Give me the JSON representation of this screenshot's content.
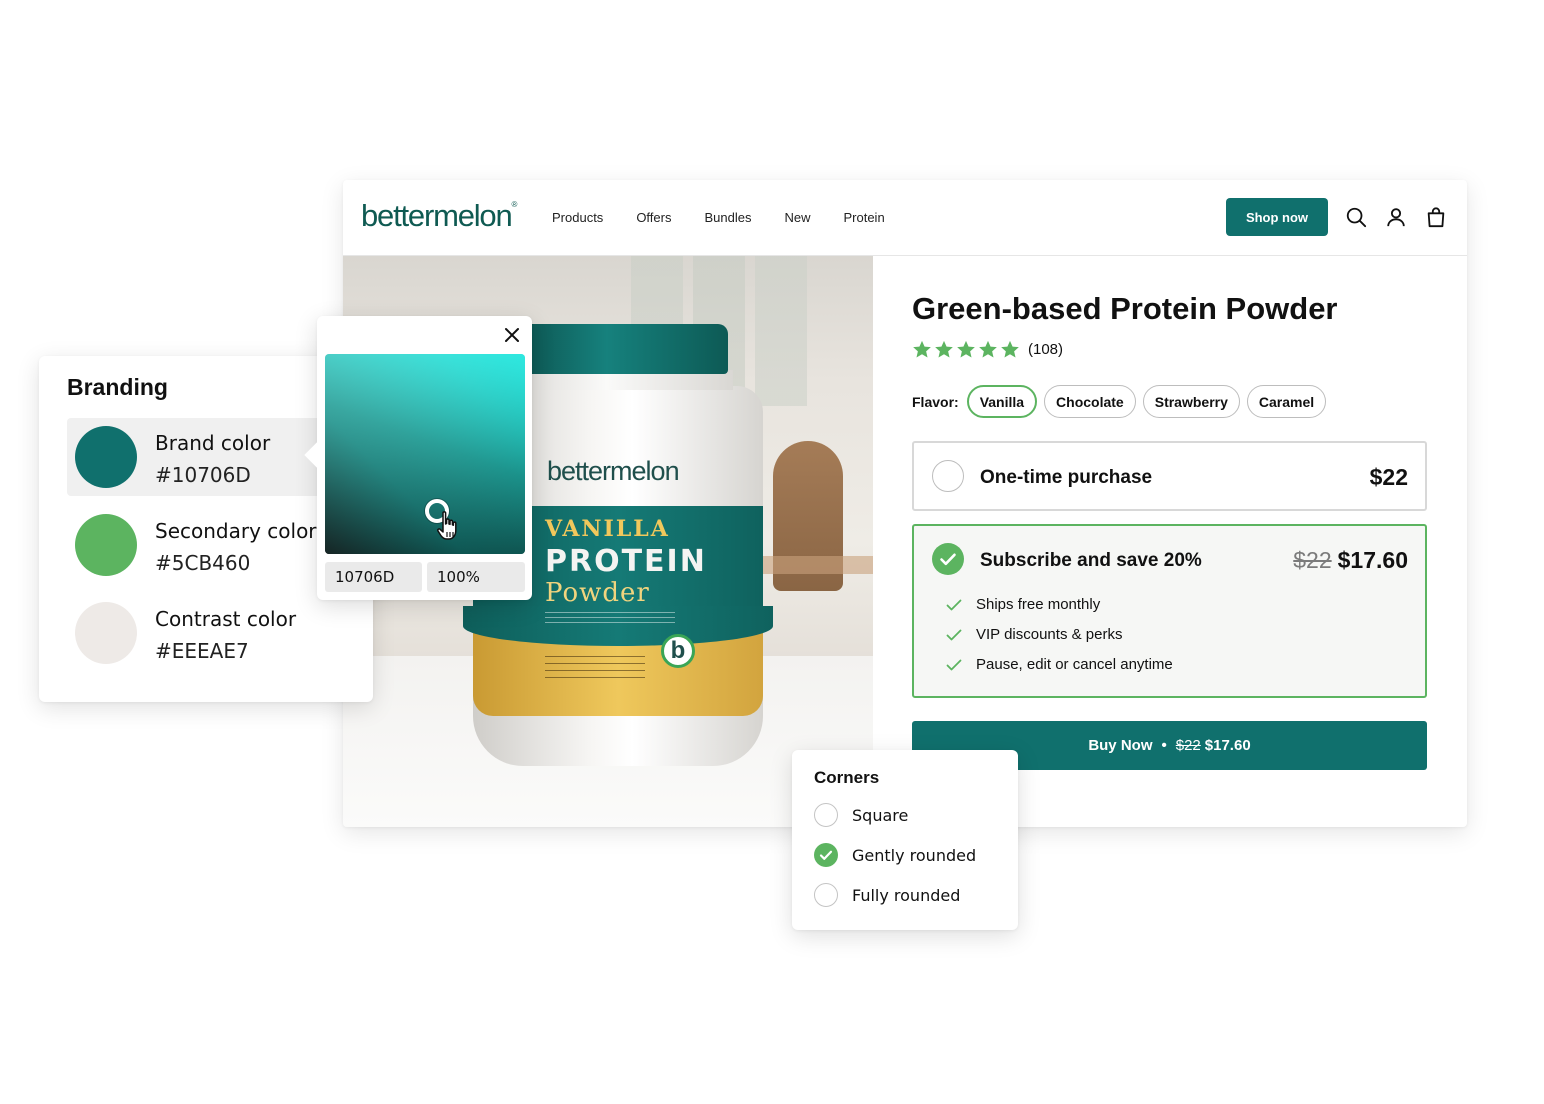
{
  "colors": {
    "brand": "#10706D",
    "secondary": "#5CB460",
    "contrast": "#EEEAE7"
  },
  "store": {
    "logo": "bettermelon",
    "nav": {
      "links": [
        "Products",
        "Offers",
        "Bundles",
        "New",
        "Protein"
      ],
      "shop_now": "Shop now",
      "icons": [
        "search-icon",
        "user-icon",
        "shopping-bag-icon"
      ]
    },
    "product_image": {
      "jar_brand": "bettermelon",
      "flavor_text": "VANILLA",
      "name_line1": "PROTEIN",
      "name_line2": "Powder",
      "badge": "b"
    },
    "product": {
      "title": "Green-based Protein Powder",
      "rating_stars": 5,
      "review_count": "(108)",
      "flavor_label": "Flavor:",
      "flavors": [
        "Vanilla",
        "Chocolate",
        "Strawberry",
        "Caramel"
      ],
      "selected_flavor": "Vanilla",
      "one_time": {
        "label": "One-time purchase",
        "price": "$22",
        "selected": false
      },
      "subscribe": {
        "label": "Subscribe and save 20%",
        "old_price": "$22",
        "price": "$17.60",
        "selected": true,
        "perks": [
          "Ships free monthly",
          "VIP discounts & perks",
          "Pause, edit or cancel anytime"
        ]
      },
      "buy_button": {
        "label": "Buy Now",
        "separator": "•",
        "old_price": "$22",
        "price": "$17.60"
      }
    }
  },
  "branding": {
    "title": "Branding",
    "swatches": [
      {
        "name": "Brand color",
        "hex": "#10706D",
        "active": true
      },
      {
        "name": "Secondary color",
        "hex": "#5CB460",
        "active": false
      },
      {
        "name": "Contrast color",
        "hex": "#EEEAE7",
        "active": false
      }
    ]
  },
  "color_picker": {
    "hex_value": "10706D",
    "opacity": "100%"
  },
  "corners": {
    "title": "Corners",
    "options": [
      {
        "label": "Square",
        "selected": false
      },
      {
        "label": "Gently rounded",
        "selected": true
      },
      {
        "label": "Fully rounded",
        "selected": false
      }
    ]
  }
}
